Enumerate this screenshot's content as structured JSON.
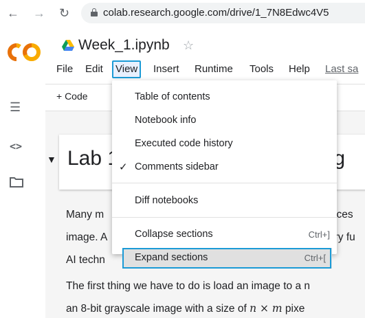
{
  "browser": {
    "back_icon": "arrow-left-icon",
    "forward_icon": "arrow-right-icon",
    "reload_icon": "reload-icon",
    "url": "colab.research.google.com/drive/1_7N8Edwc4V5"
  },
  "header": {
    "logo_text": "CO",
    "title": "Week_1.ipynb",
    "star_glyph": "☆"
  },
  "menubar": {
    "items": [
      "File",
      "Edit",
      "View",
      "Insert",
      "Runtime",
      "Tools",
      "Help"
    ],
    "last_saved": "Last sa"
  },
  "toolbar": {
    "code_label": "+ Code"
  },
  "rail": {
    "icons": [
      "toc-icon",
      "code-icon",
      "folder-icon"
    ]
  },
  "notebook": {
    "heading_start": "Lab 1",
    "heading_end": "ing",
    "para1": {
      "line1_left": "Many m",
      "line1_right": "ices",
      "line2_left": "image. A",
      "line2_right": "ary fu",
      "line3_left": "AI techn"
    },
    "para2": {
      "line1": "The first thing we have to do is load an image to a n",
      "line2_prefix": "an 8-bit grayscale image with a size of ",
      "line2_math": "n × m",
      "line2_suffix": " pixe"
    }
  },
  "view_menu": {
    "items": [
      {
        "label": "Table of contents",
        "shortcut": "",
        "checked": false
      },
      {
        "label": "Notebook info",
        "shortcut": "",
        "checked": false
      },
      {
        "label": "Executed code history",
        "shortcut": "",
        "checked": false
      },
      {
        "label": "Comments sidebar",
        "shortcut": "",
        "checked": true
      },
      {
        "label": "Diff notebooks",
        "shortcut": "",
        "checked": false
      },
      {
        "label": "Collapse sections",
        "shortcut": "Ctrl+]",
        "checked": false
      },
      {
        "label": "Expand sections",
        "shortcut": "Ctrl+[",
        "checked": false
      }
    ],
    "check_glyph": "✓"
  },
  "colors": {
    "highlight_border": "#1a9ad6",
    "logo_orange": "#f9ab00",
    "logo_dark_orange": "#e8710a"
  }
}
